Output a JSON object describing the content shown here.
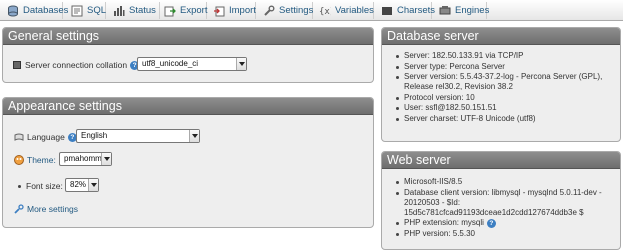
{
  "menu": {
    "tabs": [
      {
        "label": "Databases",
        "icon": "database-icon"
      },
      {
        "label": "SQL",
        "icon": "sql-icon"
      },
      {
        "label": "Status",
        "icon": "status-icon"
      },
      {
        "label": "Export",
        "icon": "export-icon"
      },
      {
        "label": "Import",
        "icon": "import-icon"
      },
      {
        "label": "Settings",
        "icon": "wrench-icon"
      },
      {
        "label": "Variables",
        "icon": "variables-icon"
      },
      {
        "label": "Charsets",
        "icon": "charsets-icon"
      },
      {
        "label": "Engines",
        "icon": "engines-icon"
      }
    ]
  },
  "general": {
    "title": "General settings",
    "collation_label": "Server connection collation",
    "collation_value": "utf8_unicode_ci"
  },
  "appearance": {
    "title": "Appearance settings",
    "language_label": "Language",
    "language_value": "English",
    "theme_label": "Theme:",
    "theme_value": "pmahomme",
    "fontsize_label": "Font size:",
    "fontsize_value": "82%",
    "more_settings": "More settings"
  },
  "dbserver": {
    "title": "Database server",
    "items": [
      "Server: 182.50.133.91 via TCP/IP",
      "Server type: Percona Server",
      "Server version: 5.5.43-37.2-log - Percona Server (GPL), Release rel30.2, Revision 38.2",
      "Protocol version: 10",
      "User: ssfl@182.50.151.51",
      "Server charset: UTF-8 Unicode (utf8)"
    ]
  },
  "webserver": {
    "title": "Web server",
    "items": [
      "Microsoft-IIS/8.5",
      "Database client version: libmysql - mysqlnd 5.0.11-dev - 20120503 - $Id: 15d5c781cfcad91193dceae1d2cdd127674ddb3e $",
      "PHP extension: mysqli",
      "PHP version: 5.5.30"
    ]
  },
  "colors": {
    "link": "#235a81",
    "panel_head": "#7a7a7a",
    "panel_bg": "#eeeeee"
  }
}
